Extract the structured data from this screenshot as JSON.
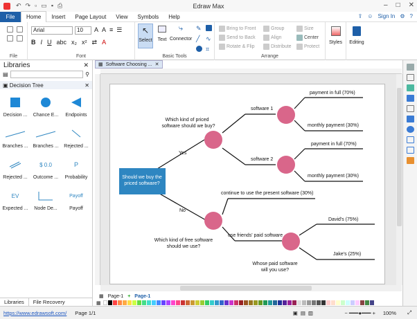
{
  "window": {
    "title": "Edraw Max"
  },
  "menu": {
    "file": "File",
    "items": [
      "Home",
      "Insert",
      "Page Layout",
      "View",
      "Symbols",
      "Help"
    ],
    "sign_in": "Sign In"
  },
  "ribbon": {
    "font_name": "Arial",
    "font_size": "10",
    "groups": {
      "file": "File",
      "font": "Font",
      "basic_tools": "Basic Tools",
      "arrange": "Arrange"
    },
    "tools": {
      "select": "Select",
      "text": "Text",
      "connector": "Connector"
    },
    "arrange": {
      "bring_to_front": "Bring to Front",
      "send_to_back": "Send to Back",
      "rotate_flip": "Rotate & Flip",
      "group": "Group",
      "align": "Align",
      "distribute": "Distribute",
      "size": "Size",
      "center": "Center",
      "protect": "Protect"
    },
    "styles": "Styles",
    "editing": "Editing"
  },
  "sidebar": {
    "title": "Libraries",
    "category": "Decision Tree",
    "shapes": [
      "Decision ...",
      "Chance E...",
      "Endpoints",
      "Branches ...",
      "Branches ...",
      "Rejected ...",
      "Rejected ...",
      "Outcome ...",
      "Probability",
      "Expected ...",
      "Node De...",
      "Payoff"
    ],
    "glyphs": {
      "outcome": "$ 0.0",
      "probability": "P",
      "ev": "EV",
      "payoff": "Payoff"
    },
    "footer_tabs": [
      "Libraries",
      "File Recovery"
    ]
  },
  "doc_tab": "Software Choosing ...",
  "diagram": {
    "root": "Should we buy the priced software?",
    "yes": "Yes",
    "no": "No",
    "q1": "Which kind of priced software should we buy?",
    "q2": "Which kind of free software should we use?",
    "q3": "Whose paid software will you use?",
    "sw1": "software 1",
    "sw2": "software 2",
    "pay_full_1": "payment in full (70%)",
    "monthly_1": "monthly payment (30%)",
    "pay_full_2": "payment in full (70%)",
    "monthly_2": "monthly payment (30%)",
    "continue": "continue to use the present software (30%)",
    "friends": "use friends' paid software",
    "davids": "David's (75%)",
    "jakes": "Jake's (25%)",
    "colors": {
      "root": "#2e86c1",
      "chance": "#d9668a"
    }
  },
  "pages": {
    "current": "Page-1",
    "tab": "Page-1"
  },
  "status": {
    "url": "https://www.edrawsoft.com/",
    "page": "Page 1/1",
    "zoom": "100%"
  }
}
